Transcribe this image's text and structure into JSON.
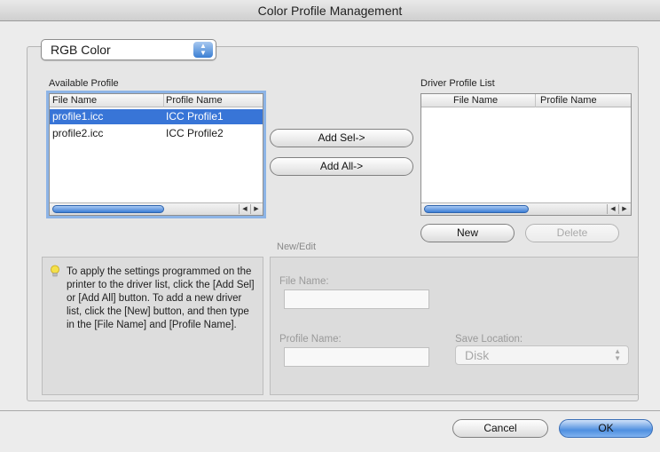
{
  "window": {
    "title": "Color Profile Management"
  },
  "color_mode": {
    "selected": "RGB Color"
  },
  "available": {
    "label": "Available Profile",
    "columns": [
      "File Name",
      "Profile Name"
    ],
    "rows": [
      {
        "file": "profile1.icc",
        "profile": "ICC Profile1",
        "selected": true
      },
      {
        "file": "profile2.icc",
        "profile": "ICC Profile2",
        "selected": false
      }
    ]
  },
  "driver": {
    "label": "Driver Profile List",
    "columns": [
      "File Name",
      "Profile Name"
    ],
    "rows": []
  },
  "buttons": {
    "add_sel": "Add Sel->",
    "add_all": "Add All->",
    "new": "New",
    "delete": "Delete",
    "cancel": "Cancel",
    "ok": "OK"
  },
  "help": {
    "text": "To apply the settings programmed on the printer to the driver list, click the [Add Sel] or [Add All] button. To add a new driver list, click the [New] button, and then type in the [File Name] and [Profile Name]."
  },
  "new_edit": {
    "label": "New/Edit",
    "file_name_label": "File Name:",
    "file_name_value": "",
    "profile_name_label": "Profile Name:",
    "profile_name_value": "",
    "save_location_label": "Save Location:",
    "save_location_value": "Disk"
  }
}
